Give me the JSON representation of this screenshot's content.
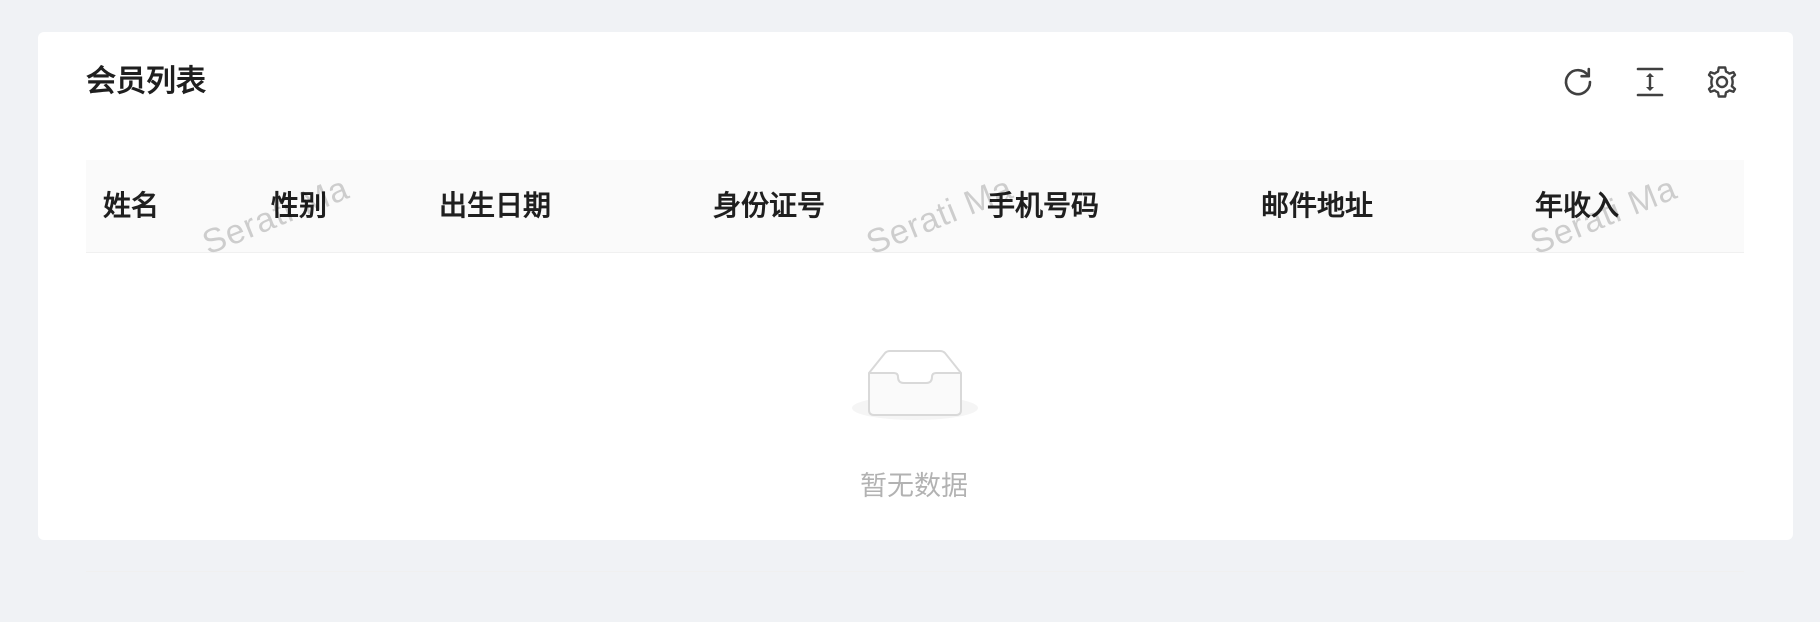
{
  "card": {
    "title": "会员列表"
  },
  "toolbar": {
    "buttons": [
      {
        "name": "reload-button",
        "icon": "reload-icon"
      },
      {
        "name": "density-button",
        "icon": "column-height-icon"
      },
      {
        "name": "settings-button",
        "icon": "gear-icon"
      }
    ]
  },
  "table": {
    "columns": [
      "姓名",
      "性别",
      "出生日期",
      "身份证号",
      "手机号码",
      "邮件地址",
      "年收入"
    ],
    "empty_text": "暂无数据"
  },
  "watermark": {
    "text": "Serati Ma"
  },
  "colors": {
    "page_background": "#f0f2f5",
    "card_background": "#ffffff",
    "header_background": "#fafafa",
    "text_primary": "#1f1f1f",
    "icon_color": "#404040",
    "muted_text": "#bfbfbf"
  }
}
